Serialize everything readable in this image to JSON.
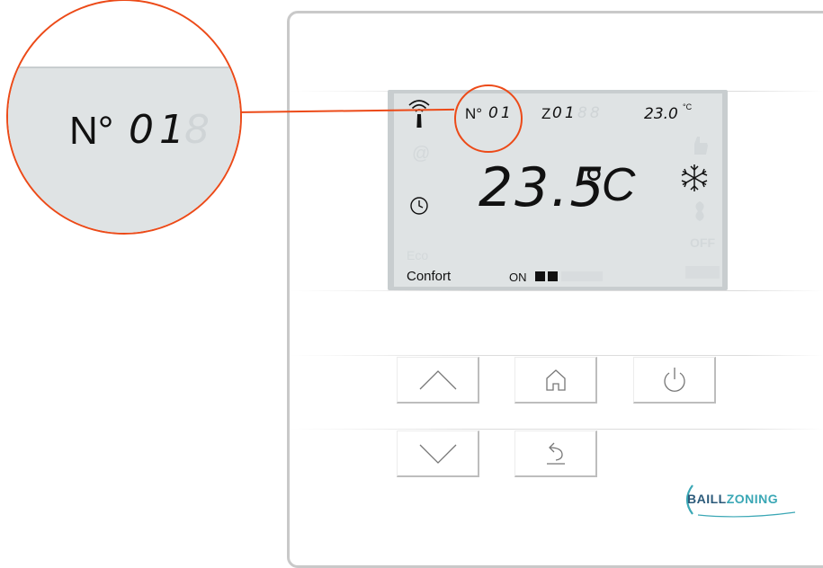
{
  "magnifier": {
    "label": "N°",
    "digits": "01",
    "ghost_digit": "8"
  },
  "lcd": {
    "device_number_label": "N°",
    "device_number": "01",
    "zone_label": "Z",
    "zone_number": "01",
    "setpoint": "23.0",
    "setpoint_unit": "°C",
    "room_temperature": "23.5",
    "room_temperature_unit": "°C",
    "ghost_digits": "8",
    "mode_label": "Confort",
    "status_label": "ON",
    "faded_eco": "Eco",
    "faded_off": "OFF",
    "faded_at": "@"
  },
  "buttons": {
    "up": "up-arrow",
    "home": "home",
    "power": "power",
    "down": "down-arrow",
    "back": "back-arrow"
  },
  "brand": {
    "prefix": "BAILL",
    "suffix": "ZONING",
    "prefix_color": "#2b5a7a",
    "suffix_color": "#3aa7b5"
  },
  "accent_color": "#ec4a18"
}
